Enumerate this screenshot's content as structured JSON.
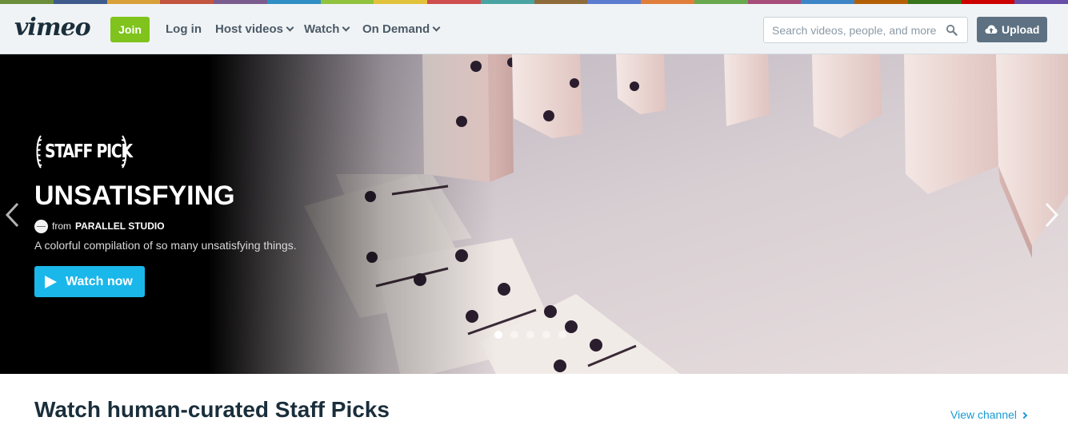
{
  "brand": {
    "logo_text": "vimeo",
    "stripe_colors": [
      "#6b8e3a",
      "#3f5b8c",
      "#d9a03a",
      "#c2553f",
      "#7a5c8e",
      "#2f8fc4",
      "#91c23e",
      "#e2c23a",
      "#cf4e4e",
      "#4aa3a3",
      "#8e6b3a",
      "#5b7bd1",
      "#e07d3a",
      "#6aa84f",
      "#a64d79",
      "#3d85c6",
      "#b45f06",
      "#38761d",
      "#cc0000",
      "#674ea7"
    ],
    "accent": "#1ab7ea",
    "join_color": "#7fc31c"
  },
  "header": {
    "join_label": "Join",
    "login_label": "Log in",
    "nav": [
      {
        "label": "Host videos",
        "icon": "chevron-down-icon"
      },
      {
        "label": "Watch",
        "icon": "chevron-down-icon"
      },
      {
        "label": "On Demand",
        "icon": "chevron-down-icon"
      }
    ],
    "search": {
      "placeholder": "Search videos, people, and more",
      "value": "",
      "icon": "search-icon"
    },
    "upload_label": "Upload",
    "upload_icon": "cloud-upload-icon"
  },
  "hero": {
    "badge": "STAFF PICK",
    "title": "UNSATISFYING",
    "from_label": "from",
    "studio": "PARALLEL STUDIO",
    "description": "A colorful compilation of so many unsatisfying things.",
    "watch_label": "Watch now",
    "slides_total": 5,
    "active_slide": 1
  },
  "section": {
    "title": "Watch human-curated Staff Picks",
    "view_channel_label": "View channel"
  }
}
